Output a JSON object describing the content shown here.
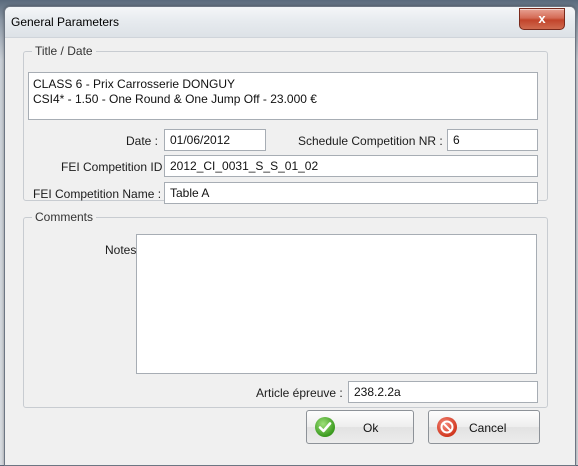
{
  "window": {
    "title": "General Parameters",
    "close_label": "x"
  },
  "title_date": {
    "legend": "Title / Date",
    "title_lines": [
      "CLASS 6 - Prix Carrosserie DONGUY",
      "CSI4* - 1.50 - One Round & One Jump Off -  23.000 €"
    ],
    "date_label": "Date :",
    "date_value": "01/06/2012",
    "schedule_label": "Schedule Competition NR :",
    "schedule_value": "6",
    "fei_id_label": "FEI Competition ID :",
    "fei_id_value": "2012_CI_0031_S_S_01_02",
    "fei_name_label": "FEI Competition Name :",
    "fei_name_value": "Table A"
  },
  "comments": {
    "legend": "Comments",
    "notes_label": "Notes",
    "notes_value": "",
    "article_label": "Article épreuve :",
    "article_value": "238.2.2a"
  },
  "buttons": {
    "ok_label": "Ok",
    "cancel_label": "Cancel"
  },
  "icons": {
    "ok": "check-icon",
    "cancel": "no-entry-icon",
    "close": "close-icon"
  }
}
